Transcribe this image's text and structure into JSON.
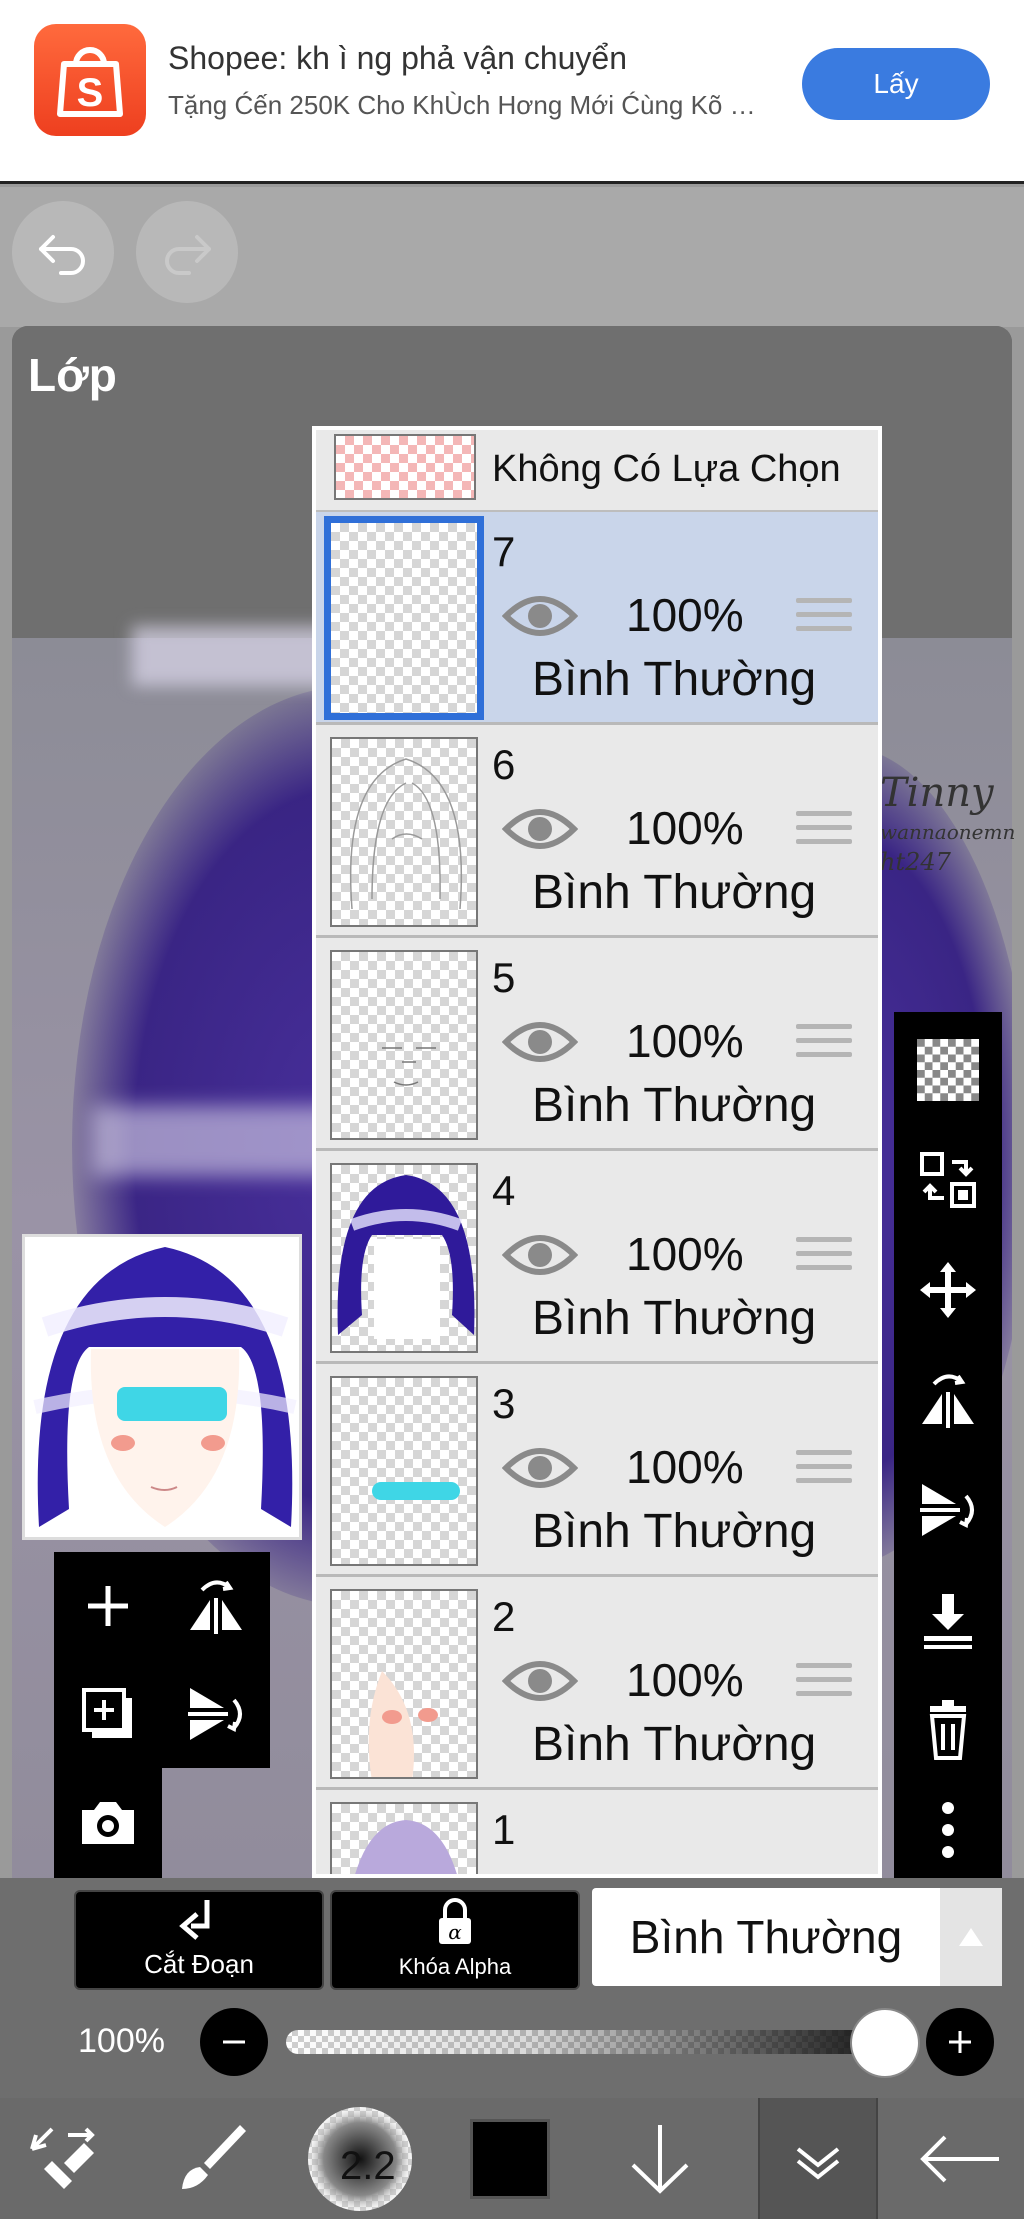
{
  "ad": {
    "title": "Shopee: kh ì ng phả vận chuyển",
    "subtitle": "Tặng Ćến 250K Cho KhÙch Hơng Mới Ćùng Kõ Sh...",
    "cta_label": "Lấy",
    "logo_letter": "S"
  },
  "panel": {
    "title": "Lớp"
  },
  "selection_row": {
    "label": "Không Có Lựa Chọn"
  },
  "layers": [
    {
      "num": "7",
      "opacity": "100%",
      "blend": "Bình Thường",
      "active": true
    },
    {
      "num": "6",
      "opacity": "100%",
      "blend": "Bình Thường",
      "active": false
    },
    {
      "num": "5",
      "opacity": "100%",
      "blend": "Bình Thường",
      "active": false
    },
    {
      "num": "4",
      "opacity": "100%",
      "blend": "Bình Thường",
      "active": false
    },
    {
      "num": "3",
      "opacity": "100%",
      "blend": "Bình Thường",
      "active": false
    },
    {
      "num": "2",
      "opacity": "100%",
      "blend": "Bình Thường",
      "active": false
    },
    {
      "num": "1",
      "opacity": "",
      "blend": "",
      "active": false
    }
  ],
  "signature": {
    "line1": "Tinny",
    "line2": "wannaonemn",
    "line3": "ht247"
  },
  "controls": {
    "clip_label": "Cắt Đoạn",
    "alpha_lock_label": "Khóa Alpha",
    "blend_mode": "Bình Thường",
    "opacity_label": "100%",
    "opacity_value": 1.0
  },
  "bottombar": {
    "brush_size": "2.2",
    "color": "#000000"
  },
  "colors": {
    "accent": "#2f6fd8",
    "ad_button": "#3a7be0",
    "shopee": "#ee4d2d",
    "hair": "#2a1280",
    "visor": "#3fd6e6"
  }
}
